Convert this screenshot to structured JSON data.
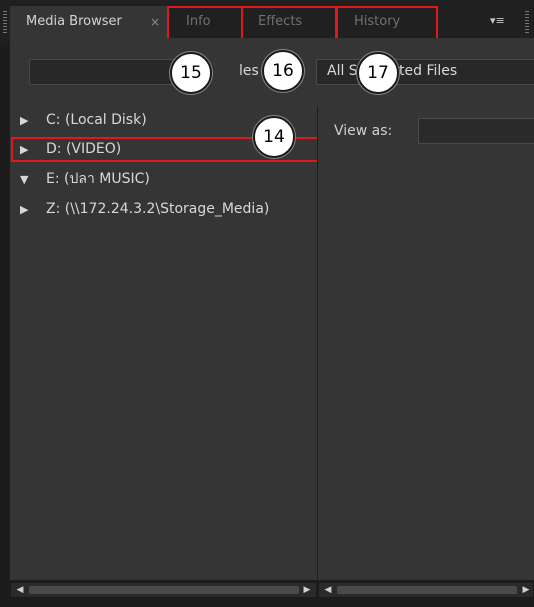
{
  "tabs": {
    "media_browser": "Media Browser",
    "close_glyph": "×",
    "info": "Info",
    "effects": "Effects",
    "history": "History",
    "menu_glyph": "▾≡"
  },
  "toolbar": {
    "filter_text": "les o",
    "view_text_a": "All S",
    "view_text_b": "ted Files"
  },
  "badges": {
    "b14": "14",
    "b15": "15",
    "b16": "16",
    "b17": "17"
  },
  "tree": {
    "items": [
      {
        "label": "C: (Local Disk)",
        "expanded": false
      },
      {
        "label": "D: (VIDEO)",
        "expanded": false
      },
      {
        "label": "E: (ปลา MUSIC)",
        "expanded": true
      },
      {
        "label": "Z: (\\\\172.24.3.2\\Storage_Media)",
        "expanded": false
      }
    ]
  },
  "right_panel": {
    "view_as_label": "View as:"
  },
  "glyphs": {
    "collapsed": "▶",
    "expanded": "▼",
    "dropdown": "▼",
    "scroll_left": "◀",
    "scroll_right": "▶"
  },
  "colors": {
    "highlight": "#e01818",
    "panel": "#353535",
    "background": "#1c1c1c"
  }
}
